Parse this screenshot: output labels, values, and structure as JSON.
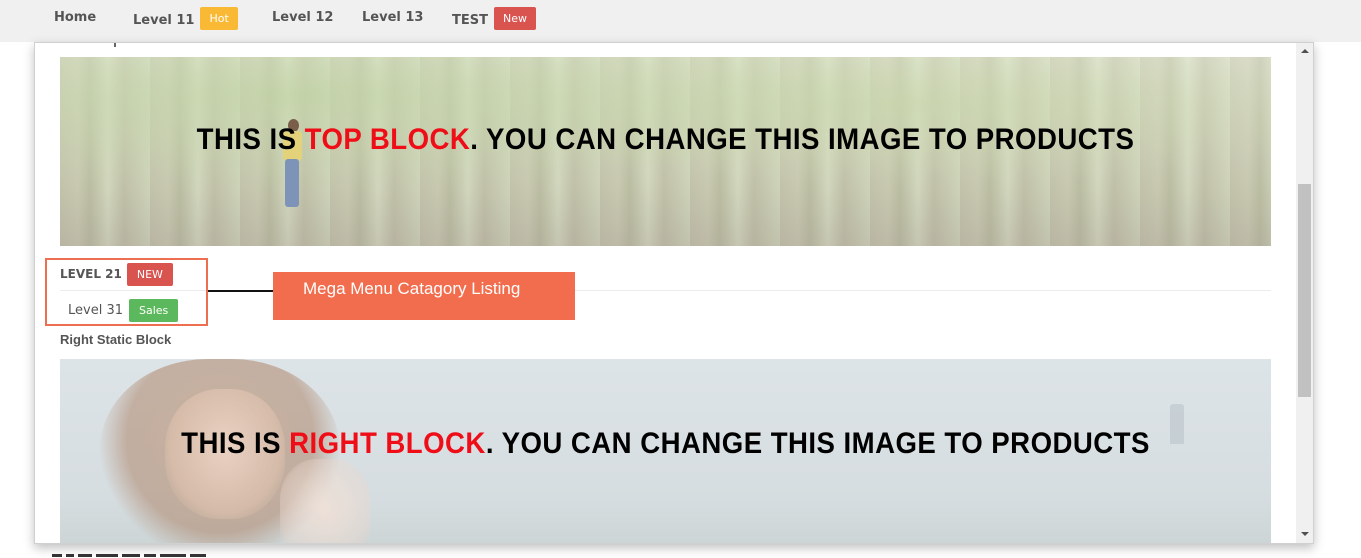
{
  "topnav": {
    "items": [
      {
        "label": "Home"
      },
      {
        "label": "Level 11",
        "badge": "Hot",
        "badge_color": "#f9b935"
      },
      {
        "label": "Level 12"
      },
      {
        "label": "Level 13"
      },
      {
        "label": "TEST",
        "badge": "New",
        "badge_color": "#d9534f"
      }
    ]
  },
  "popup": {
    "top_block": {
      "text_prefix": "THIS IS ",
      "text_highlight": "TOP BLOCK",
      "text_suffix": ". YOU CAN CHANGE THIS IMAGE TO PRODUCTS",
      "highlight_color": "#ef0d17"
    },
    "category": {
      "level21": {
        "label": "LEVEL 21",
        "badge": "NEW",
        "badge_color": "#d9534f"
      },
      "level31": {
        "label": "Level 31",
        "badge": "Sales",
        "badge_color": "#5cb85c"
      }
    },
    "annotation": {
      "label": "Mega Menu Catagory Listing",
      "color": "#f26d4d",
      "border_color": "#ee6e52"
    },
    "right_block": {
      "title": "Right Static Block",
      "text_prefix": "THIS IS ",
      "text_highlight": "RIGHT BLOCK",
      "text_suffix": ". YOU CAN CHANGE THIS IMAGE TO PRODUCTS",
      "highlight_color": "#ef0d17"
    }
  },
  "scrollbar": {
    "up_icon": "triangle-up",
    "down_icon": "triangle-down"
  }
}
